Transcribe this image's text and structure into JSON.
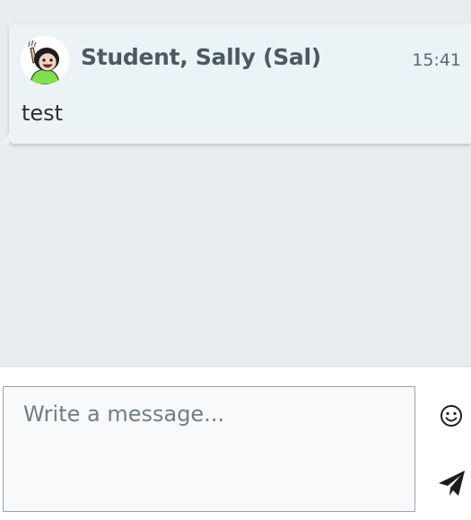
{
  "message": {
    "sender": "Student, Sally (Sal)",
    "time": "15:41",
    "text": "test"
  },
  "composer": {
    "placeholder": "Write a message...",
    "emoji_icon": "smile-icon",
    "send_icon": "paper-plane-icon"
  },
  "colors": {
    "chat_background": "#e8ecf0",
    "message_card": "#ecf3f7",
    "sender_name": "#4a5964"
  }
}
